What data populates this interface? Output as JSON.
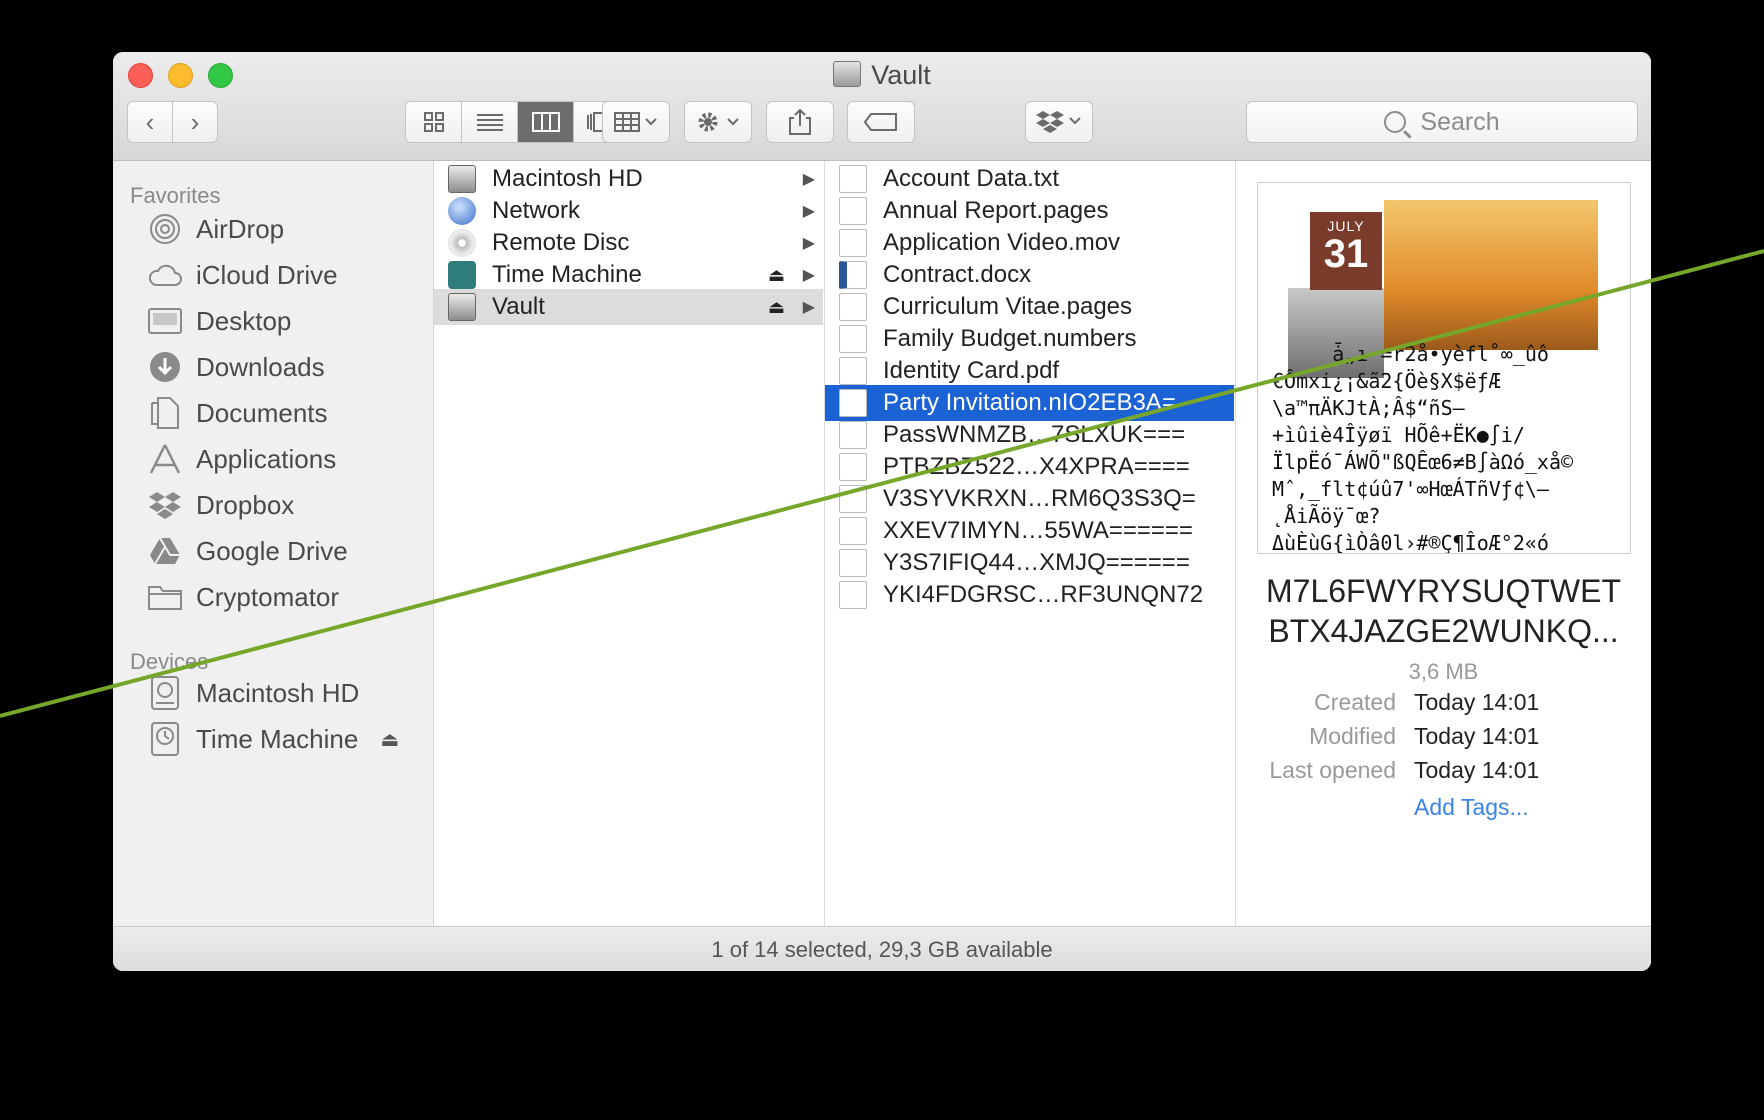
{
  "window": {
    "title": "Vault"
  },
  "toolbar": {
    "back": "‹",
    "forward": "›",
    "search_placeholder": "Search"
  },
  "sidebar": {
    "favorites_header": "Favorites",
    "favorites": [
      {
        "label": "AirDrop",
        "icon": "airdrop-icon"
      },
      {
        "label": "iCloud Drive",
        "icon": "cloud-icon"
      },
      {
        "label": "Desktop",
        "icon": "desktop-icon"
      },
      {
        "label": "Downloads",
        "icon": "downloads-icon"
      },
      {
        "label": "Documents",
        "icon": "documents-icon"
      },
      {
        "label": "Applications",
        "icon": "applications-icon"
      },
      {
        "label": "Dropbox",
        "icon": "dropbox-icon"
      },
      {
        "label": "Google Drive",
        "icon": "google-drive-icon"
      },
      {
        "label": "Cryptomator",
        "icon": "folder-icon"
      }
    ],
    "devices_header": "Devices",
    "devices": [
      {
        "label": "Macintosh HD",
        "icon": "harddrive-icon"
      },
      {
        "label": "Time Machine",
        "icon": "time-machine-icon"
      }
    ]
  },
  "column1": [
    {
      "label": "Macintosh HD"
    },
    {
      "label": "Network"
    },
    {
      "label": "Remote Disc"
    },
    {
      "label": "Time Machine"
    },
    {
      "label": "Vault"
    }
  ],
  "column2": [
    {
      "label": "Account Data.txt"
    },
    {
      "label": "Annual Report.pages"
    },
    {
      "label": "Application Video.mov"
    },
    {
      "label": "Contract.docx"
    },
    {
      "label": "Curriculum Vitae.pages"
    },
    {
      "label": "Family Budget.numbers"
    },
    {
      "label": "Identity Card.pdf"
    },
    {
      "label": "Party Invitation.nIO2EB3A="
    },
    {
      "label": "PassWNMZB…7SLXUK==="
    },
    {
      "label": "PTBZBZ522…X4XPRA===="
    },
    {
      "label": "V3SYVKRXN…RM6Q3S3Q="
    },
    {
      "label": "XXEV7IMYN…55WA======"
    },
    {
      "label": "Y3S7IFIQ44…XMJQ======"
    },
    {
      "label": "YKI4FDGRSC…RF3UNQN72"
    }
  ],
  "preview": {
    "calendar_month": "JULY",
    "calendar_day": "31",
    "garbled_text": "     ǡ„ı =r2å•yèfl˚∞_ûô\n€Ômxi¿¡&ã2{Öè§X$ëƒÆ\n\\a™πÄKJtÀ;Â$“ñS—\n+ìûiè4Îÿøï HÕê+ËK●∫i/\nÏlpËó¯ÁWÕ\"ßQÊœ6≠B∫àΩó_xå©\nMˆ,_flt¢úû7'∞HœÁTñVƒ¢\\–\n˛ÅiÃöÿ¯œ?\nΔùÈùG{ìÒâ0l›#®Ç¶ÎoÆ°2«ó",
    "filename_line1": "M7L6FWYRYSUQTWET",
    "filename_line2": "BTX4JAZGE2WUNKQ...",
    "size": "3,6 MB",
    "created_label": "Created",
    "created_value": "Today 14:01",
    "modified_label": "Modified",
    "modified_value": "Today 14:01",
    "opened_label": "Last opened",
    "opened_value": "Today 14:01",
    "add_tags": "Add Tags..."
  },
  "status": {
    "text": "1 of 14 selected, 29,3 GB available"
  },
  "colors": {
    "selection": "#1b63d5",
    "overlay_line": "#76a62a",
    "tag_link": "#3b82e6"
  }
}
